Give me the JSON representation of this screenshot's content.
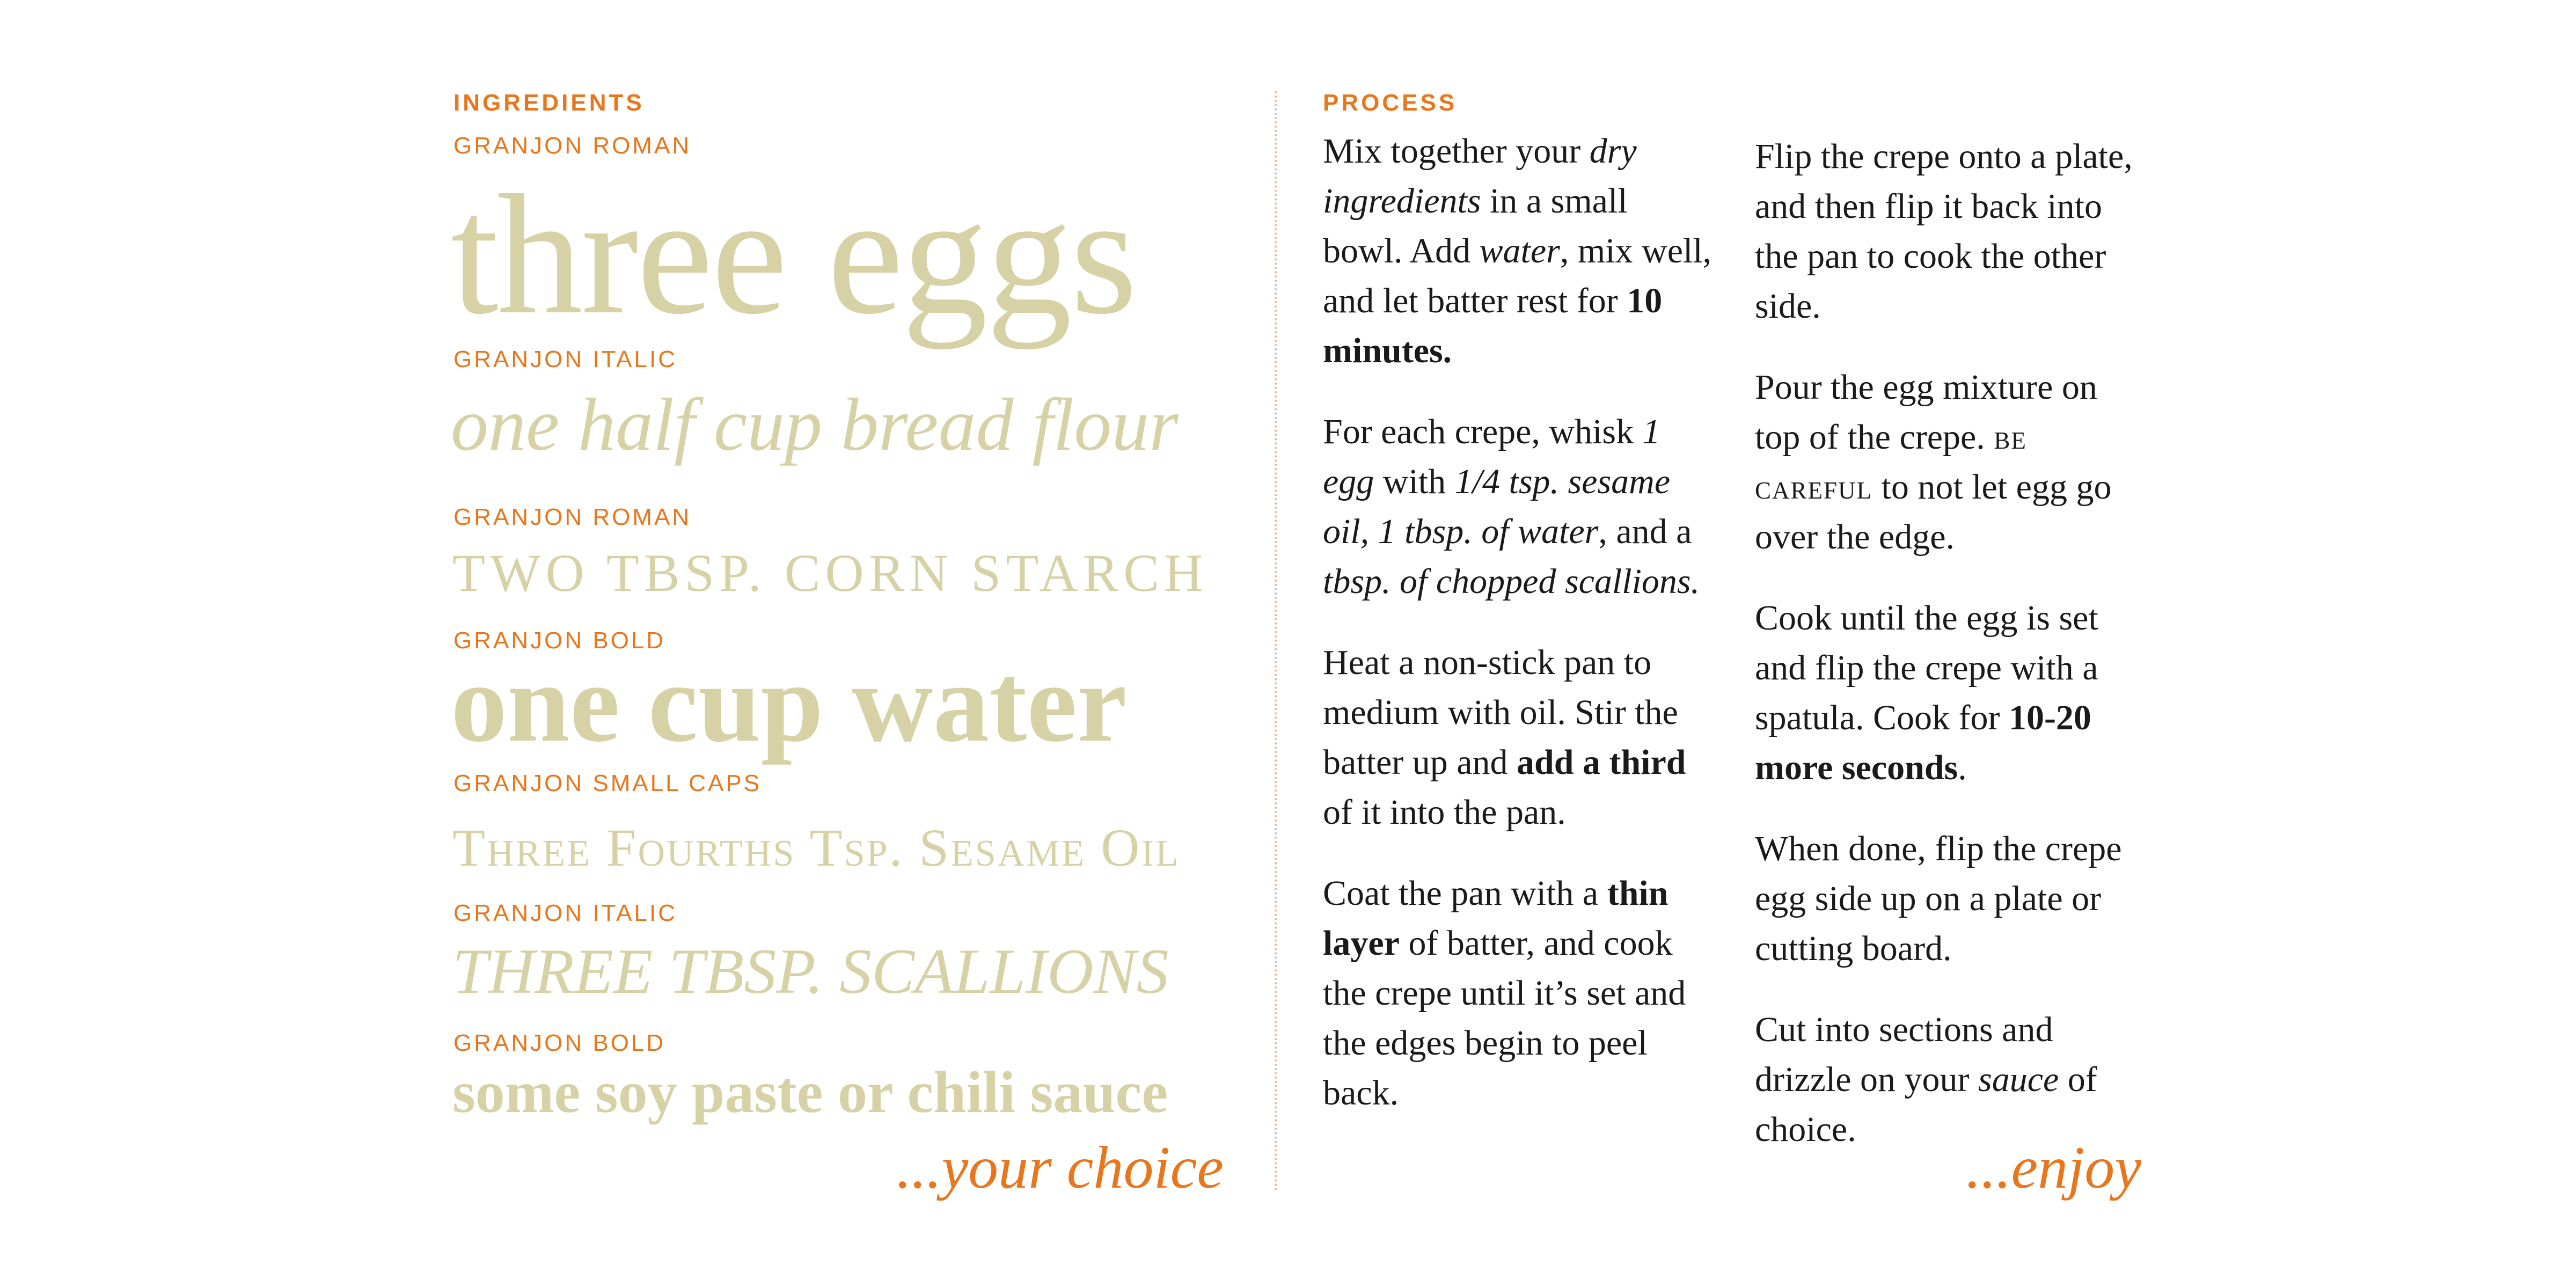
{
  "ingredients": {
    "heading": "INGREDIENTS",
    "items": [
      {
        "font_label": "GRANJON ROMAN",
        "text": "three eggs"
      },
      {
        "font_label": "GRANJON ITALIC",
        "text": "one half cup bread flour"
      },
      {
        "font_label": "GRANJON ROMAN",
        "text": "TWO TBSP. CORN STARCH"
      },
      {
        "font_label": "GRANJON BOLD",
        "text": "one cup water"
      },
      {
        "font_label": "GRANJON SMALL CAPS",
        "text": "Three Fourths Tsp. Sesame Oil"
      },
      {
        "font_label": "GRANJON ITALIC",
        "text": "THREE TBSP. SCALLIONS"
      },
      {
        "font_label": "GRANJON BOLD",
        "text": "some soy paste or chili sauce"
      }
    ],
    "signoff": "...your choice"
  },
  "process": {
    "heading": "PROCESS",
    "paragraphs": [
      [
        {
          "t": "Mix together your "
        },
        {
          "t": "dry ingredients",
          "s": "i"
        },
        {
          "t": " in a small bowl. Add "
        },
        {
          "t": "water",
          "s": "i"
        },
        {
          "t": ", mix well, and let batter rest for "
        },
        {
          "t": "10 minutes.",
          "s": "b"
        }
      ],
      [
        {
          "t": "For each crepe, whisk "
        },
        {
          "t": "1 egg",
          "s": "i"
        },
        {
          "t": " with "
        },
        {
          "t": "1/4 tsp. sesame oil, 1 tbsp. of water",
          "s": "i"
        },
        {
          "t": ", and a "
        },
        {
          "t": "tbsp. of chopped scallions.",
          "s": "i"
        }
      ],
      [
        {
          "t": "Heat a non-stick pan to medium with oil. Stir the batter up and "
        },
        {
          "t": "add a third",
          "s": "b"
        },
        {
          "t": " of it into the pan."
        }
      ],
      [
        {
          "t": "Coat the pan with a "
        },
        {
          "t": "thin layer",
          "s": "b"
        },
        {
          "t": " of batter, and cook the crepe until it’s set and the edges begin to peel back."
        }
      ],
      [
        {
          "t": "Flip the crepe onto a plate, and then flip it back into the pan to cook the other side."
        }
      ],
      [
        {
          "t": "Pour the egg mixture on top of the crepe. "
        },
        {
          "t": "BE CAREFUL",
          "s": "sc"
        },
        {
          "t": " to not let egg go over the edge."
        }
      ],
      [
        {
          "t": "Cook until the egg is set and flip the crepe with a spatula. Cook for "
        },
        {
          "t": "10-20 more seconds",
          "s": "b"
        },
        {
          "t": "."
        }
      ],
      [
        {
          "t": "When done, flip the crepe egg side up on a plate or cutting board."
        }
      ],
      [
        {
          "t": "Cut into sections and drizzle on your "
        },
        {
          "t": "sauce",
          "s": "i"
        },
        {
          "t": " of choice."
        }
      ]
    ],
    "signoff": "...enjoy"
  }
}
